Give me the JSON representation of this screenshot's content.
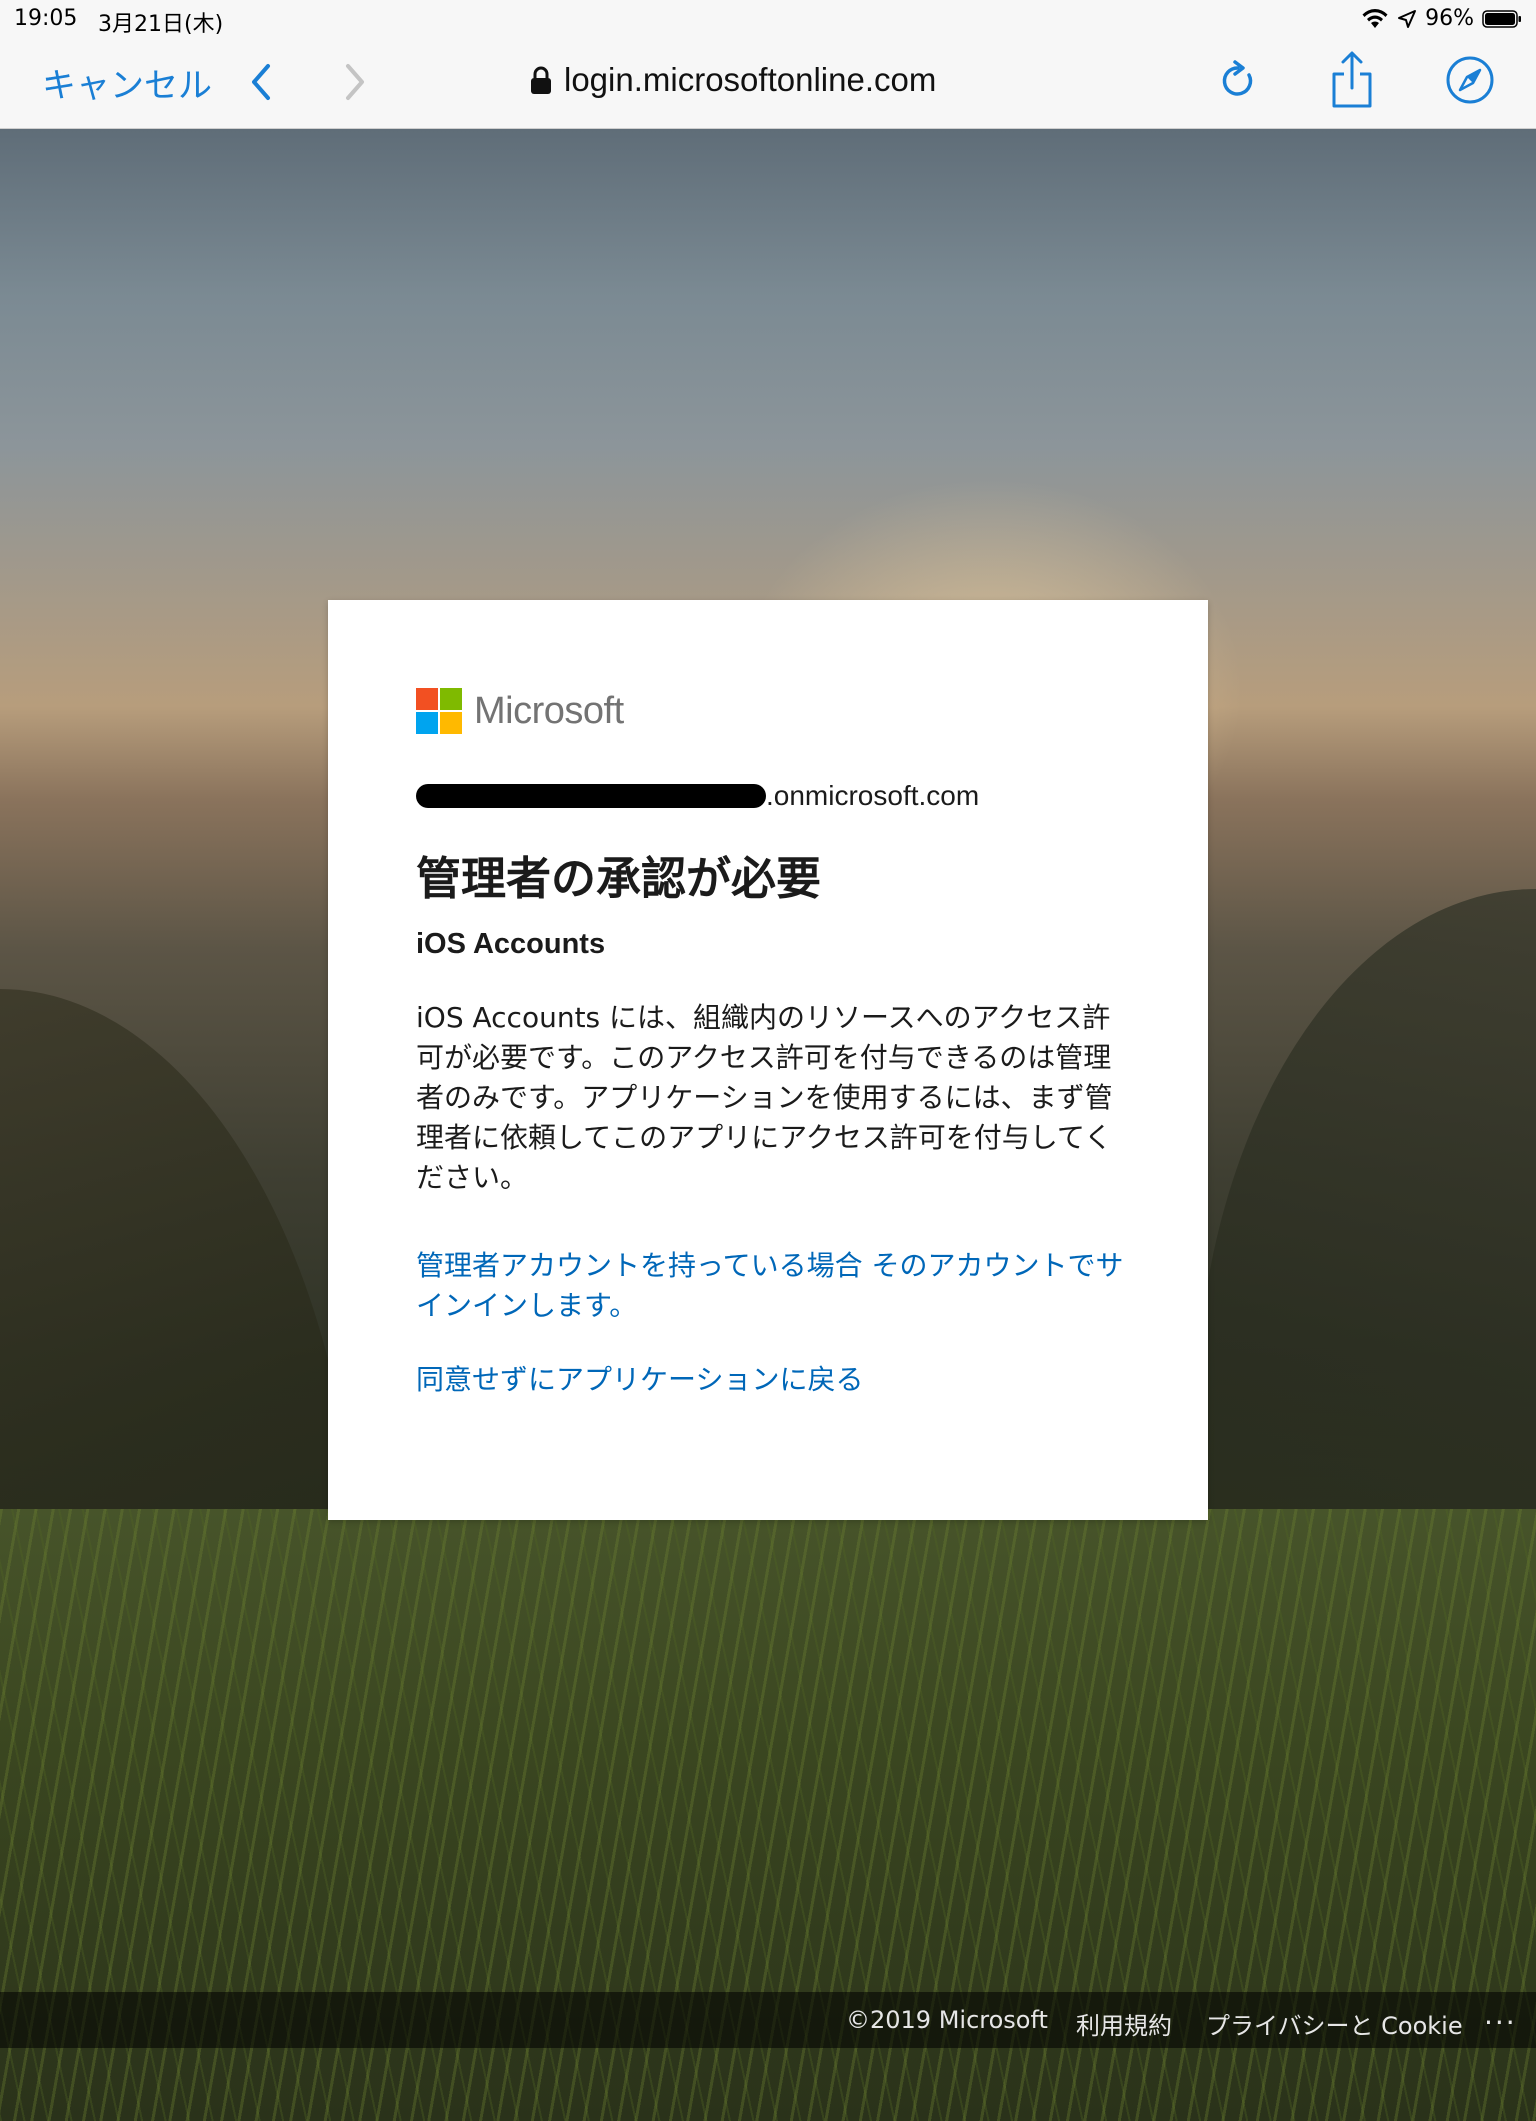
{
  "status_bar": {
    "time": "19:05",
    "date": "3月21日(木)",
    "battery": "96%"
  },
  "toolbar": {
    "cancel_label": "キャンセル",
    "url": "login.microsoftonline.com"
  },
  "card": {
    "brand": "Microsoft",
    "account_domain": ".onmicrosoft.com",
    "title": "管理者の承認が必要",
    "app_name": "iOS Accounts",
    "description": "iOS Accounts には、組織内のリソースへのアクセス許可が必要です。このアクセス許可を付与できるのは管理者のみです。アプリケーションを使用するには、まず管理者に依頼してこのアプリにアクセス許可を付与してください。",
    "admin_link": "管理者アカウントを持っている場合 そのアカウントでサインインします。",
    "return_link": "同意せずにアプリケーションに戻る"
  },
  "footer": {
    "copyright": "©2019 Microsoft",
    "terms": "利用規約",
    "privacy": "プライバシーと Cookie",
    "more": "..."
  },
  "colors": {
    "link": "#0067b8",
    "ios_accent": "#1a7fd5",
    "ms_red": "#f25022",
    "ms_green": "#7fba00",
    "ms_blue": "#00a4ef",
    "ms_yellow": "#ffb900"
  }
}
